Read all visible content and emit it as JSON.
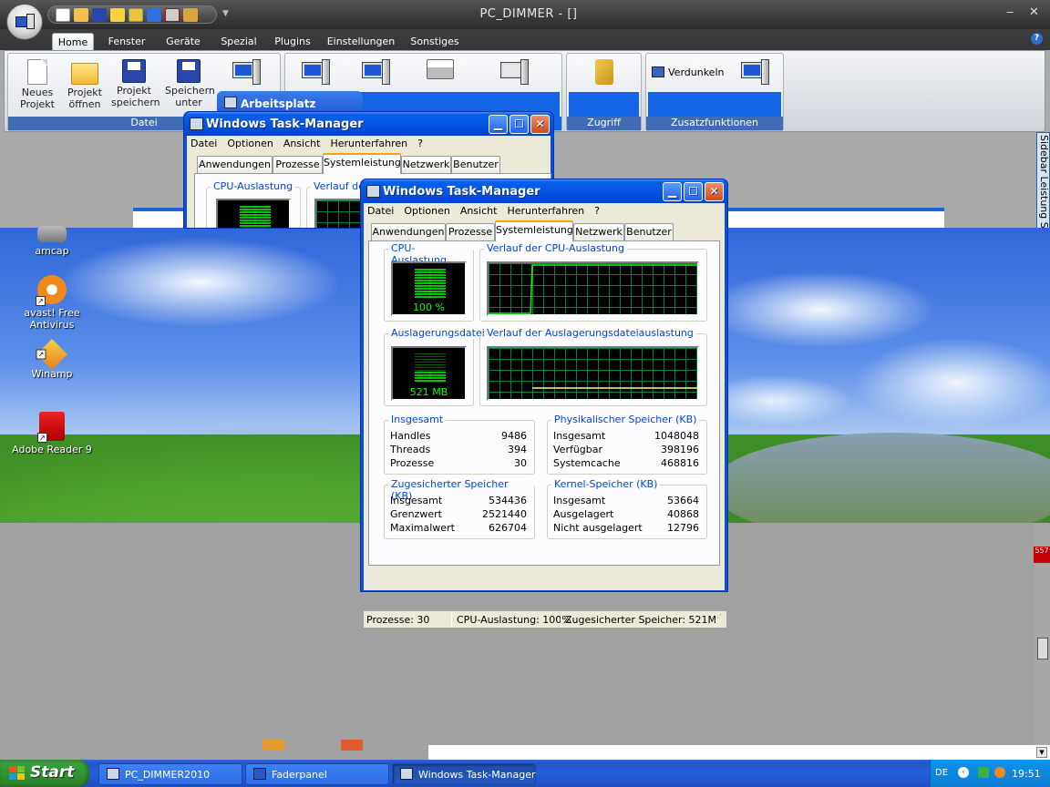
{
  "app": {
    "title": "PC_DIMMER - []",
    "tabs": [
      "Home",
      "Fenster",
      "Geräte",
      "Spezial",
      "Plugins",
      "Einstellungen",
      "Sonstiges"
    ],
    "groups": {
      "datei": {
        "label": "Datei",
        "buttons": [
          {
            "label": "Neues Projekt"
          },
          {
            "label": "Projekt öffnen"
          },
          {
            "label": "Projekt speichern"
          },
          {
            "label": "Speichern unter"
          }
        ]
      },
      "zugriff": {
        "label": "Zugriff"
      },
      "zusatz": {
        "label": "Zusatzfunktionen",
        "verdunkeln": "Verdunkeln"
      }
    },
    "arbeitsplatz_label": "Arbeitsplatz",
    "sidebar_tab": "Sidebar Leistung Selector",
    "min_glyph": "‒",
    "close_glyph": "✕",
    "help_glyph": "?"
  },
  "desktop_icons": [
    {
      "label": "amcap",
      "icon": "camera-icon"
    },
    {
      "label": "avast! Free Antivirus",
      "icon": "avast-icon"
    },
    {
      "label": "Winamp",
      "icon": "winamp-icon"
    },
    {
      "label": "Adobe Reader 9",
      "icon": "adobe-reader-icon"
    }
  ],
  "taskmgr_back": {
    "title": "Windows Task-Manager",
    "menu": [
      "Datei",
      "Optionen",
      "Ansicht",
      "Herunterfahren",
      "?"
    ],
    "tabs": [
      "Anwendungen",
      "Prozesse",
      "Systemleistung",
      "Netzwerk",
      "Benutzer"
    ],
    "cpu_label": "CPU-Auslastung",
    "history_label": "Verlauf der"
  },
  "taskmgr": {
    "title": "Windows Task-Manager",
    "menu": [
      "Datei",
      "Optionen",
      "Ansicht",
      "Herunterfahren",
      "?"
    ],
    "tabs": [
      "Anwendungen",
      "Prozesse",
      "Systemleistung",
      "Netzwerk",
      "Benutzer"
    ],
    "active_tab": "Systemleistung",
    "cpu": {
      "label": "CPU-Auslastung",
      "value": "100 %",
      "history_label": "Verlauf der CPU-Auslastung"
    },
    "pagefile": {
      "label": "Auslagerungsdatei",
      "value": "521 MB",
      "history_label": "Verlauf der Auslagerungsdateiauslastung"
    },
    "insgesamt": {
      "title": "Insgesamt",
      "rows": [
        {
          "k": "Handles",
          "v": "9486"
        },
        {
          "k": "Threads",
          "v": "394"
        },
        {
          "k": "Prozesse",
          "v": "30"
        }
      ]
    },
    "phys": {
      "title": "Physikalischer Speicher (KB)",
      "rows": [
        {
          "k": "Insgesamt",
          "v": "1048048"
        },
        {
          "k": "Verfügbar",
          "v": "398196"
        },
        {
          "k": "Systemcache",
          "v": "468816"
        }
      ]
    },
    "commit": {
      "title": "Zugesicherter Speicher (KB)",
      "rows": [
        {
          "k": "Insgesamt",
          "v": "534436"
        },
        {
          "k": "Grenzwert",
          "v": "2521440"
        },
        {
          "k": "Maximalwert",
          "v": "626704"
        }
      ]
    },
    "kernel": {
      "title": "Kernel-Speicher (KB)",
      "rows": [
        {
          "k": "Insgesamt",
          "v": "53664"
        },
        {
          "k": "Ausgelagert",
          "v": "40868"
        },
        {
          "k": "Nicht ausgelagert",
          "v": "12796"
        }
      ]
    },
    "status": {
      "processes": "Prozesse: 30",
      "cpu": "CPU-Auslastung: 100%",
      "commit": "Zugesicherter Speicher: 521M"
    },
    "cpu_load_fraction": 1.0
  },
  "taskbar": {
    "start": "Start",
    "buttons": [
      {
        "label": "PC_DIMMER2010"
      },
      {
        "label": "Faderpanel"
      },
      {
        "label": "Windows Task-Manager"
      }
    ],
    "lang": "DE",
    "clock": "19:51"
  },
  "misc": {
    "red_chip": "557"
  }
}
